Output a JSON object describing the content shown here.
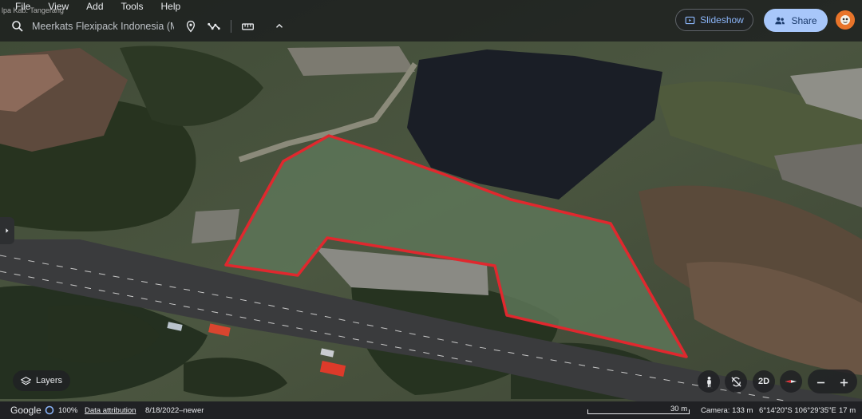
{
  "menu": [
    "File",
    "View",
    "Add",
    "Tools",
    "Help"
  ],
  "overlay_text": "lpa Kab. Tangerang",
  "search": {
    "value": "Meerkats Flexipack Indonesia (MF"
  },
  "toolbar": {
    "icons": [
      "search-icon",
      "pin-icon",
      "path-icon",
      "ruler-icon",
      "chevron-up-icon"
    ]
  },
  "actions": {
    "slideshow": "Slideshow",
    "share": "Share"
  },
  "layers_label": "Layers",
  "view_mode": "2D",
  "status": {
    "google": "Google",
    "loading": "100%",
    "attribution": "Data attribution",
    "imagery_date": "8/18/2022–newer",
    "scale": "30 m",
    "camera": "Camera: 133 m",
    "coords": "6°14'20\"S 106°29'35\"E",
    "elevation": "17 m"
  },
  "colors": {
    "accent": "#a8c7fa",
    "link": "#8ab4f8",
    "boundary": "#e0282e",
    "avatar": "#e8742a"
  }
}
